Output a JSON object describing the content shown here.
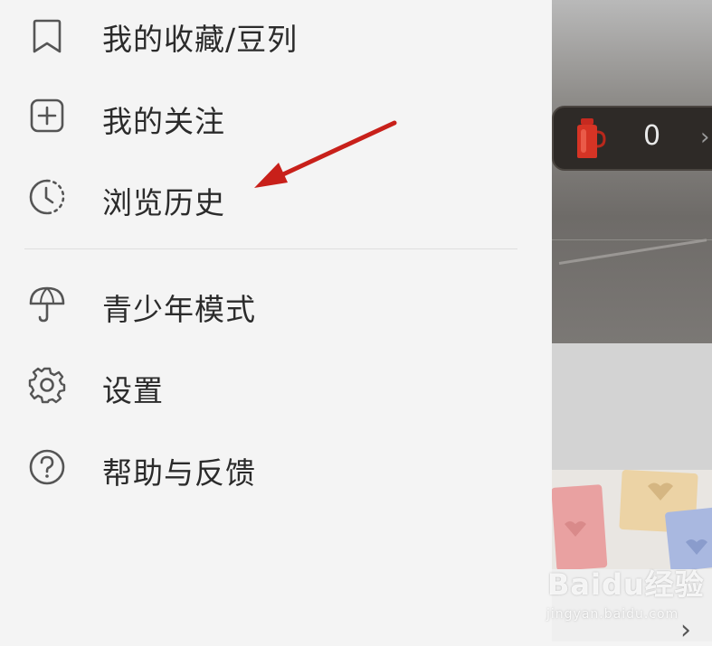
{
  "drawer": {
    "items": [
      {
        "label": "我的收藏/豆列",
        "icon": "bookmark-icon"
      },
      {
        "label": "我的关注",
        "icon": "plus-square-icon"
      },
      {
        "label": "浏览历史",
        "icon": "history-clock-icon"
      },
      {
        "label": "青少年模式",
        "icon": "umbrella-icon"
      },
      {
        "label": "设置",
        "icon": "gear-icon"
      },
      {
        "label": "帮助与反馈",
        "icon": "help-circle-icon"
      }
    ]
  },
  "background": {
    "coin_count": "0",
    "coin_arrow": "›"
  },
  "watermark": {
    "brand": "Baidu经验",
    "url": "jingyan.baidu.com"
  },
  "colors": {
    "drawer_bg": "#f4f4f4",
    "text": "#2b2b2b",
    "icon": "#555555",
    "annotation_arrow": "#c8201a"
  }
}
